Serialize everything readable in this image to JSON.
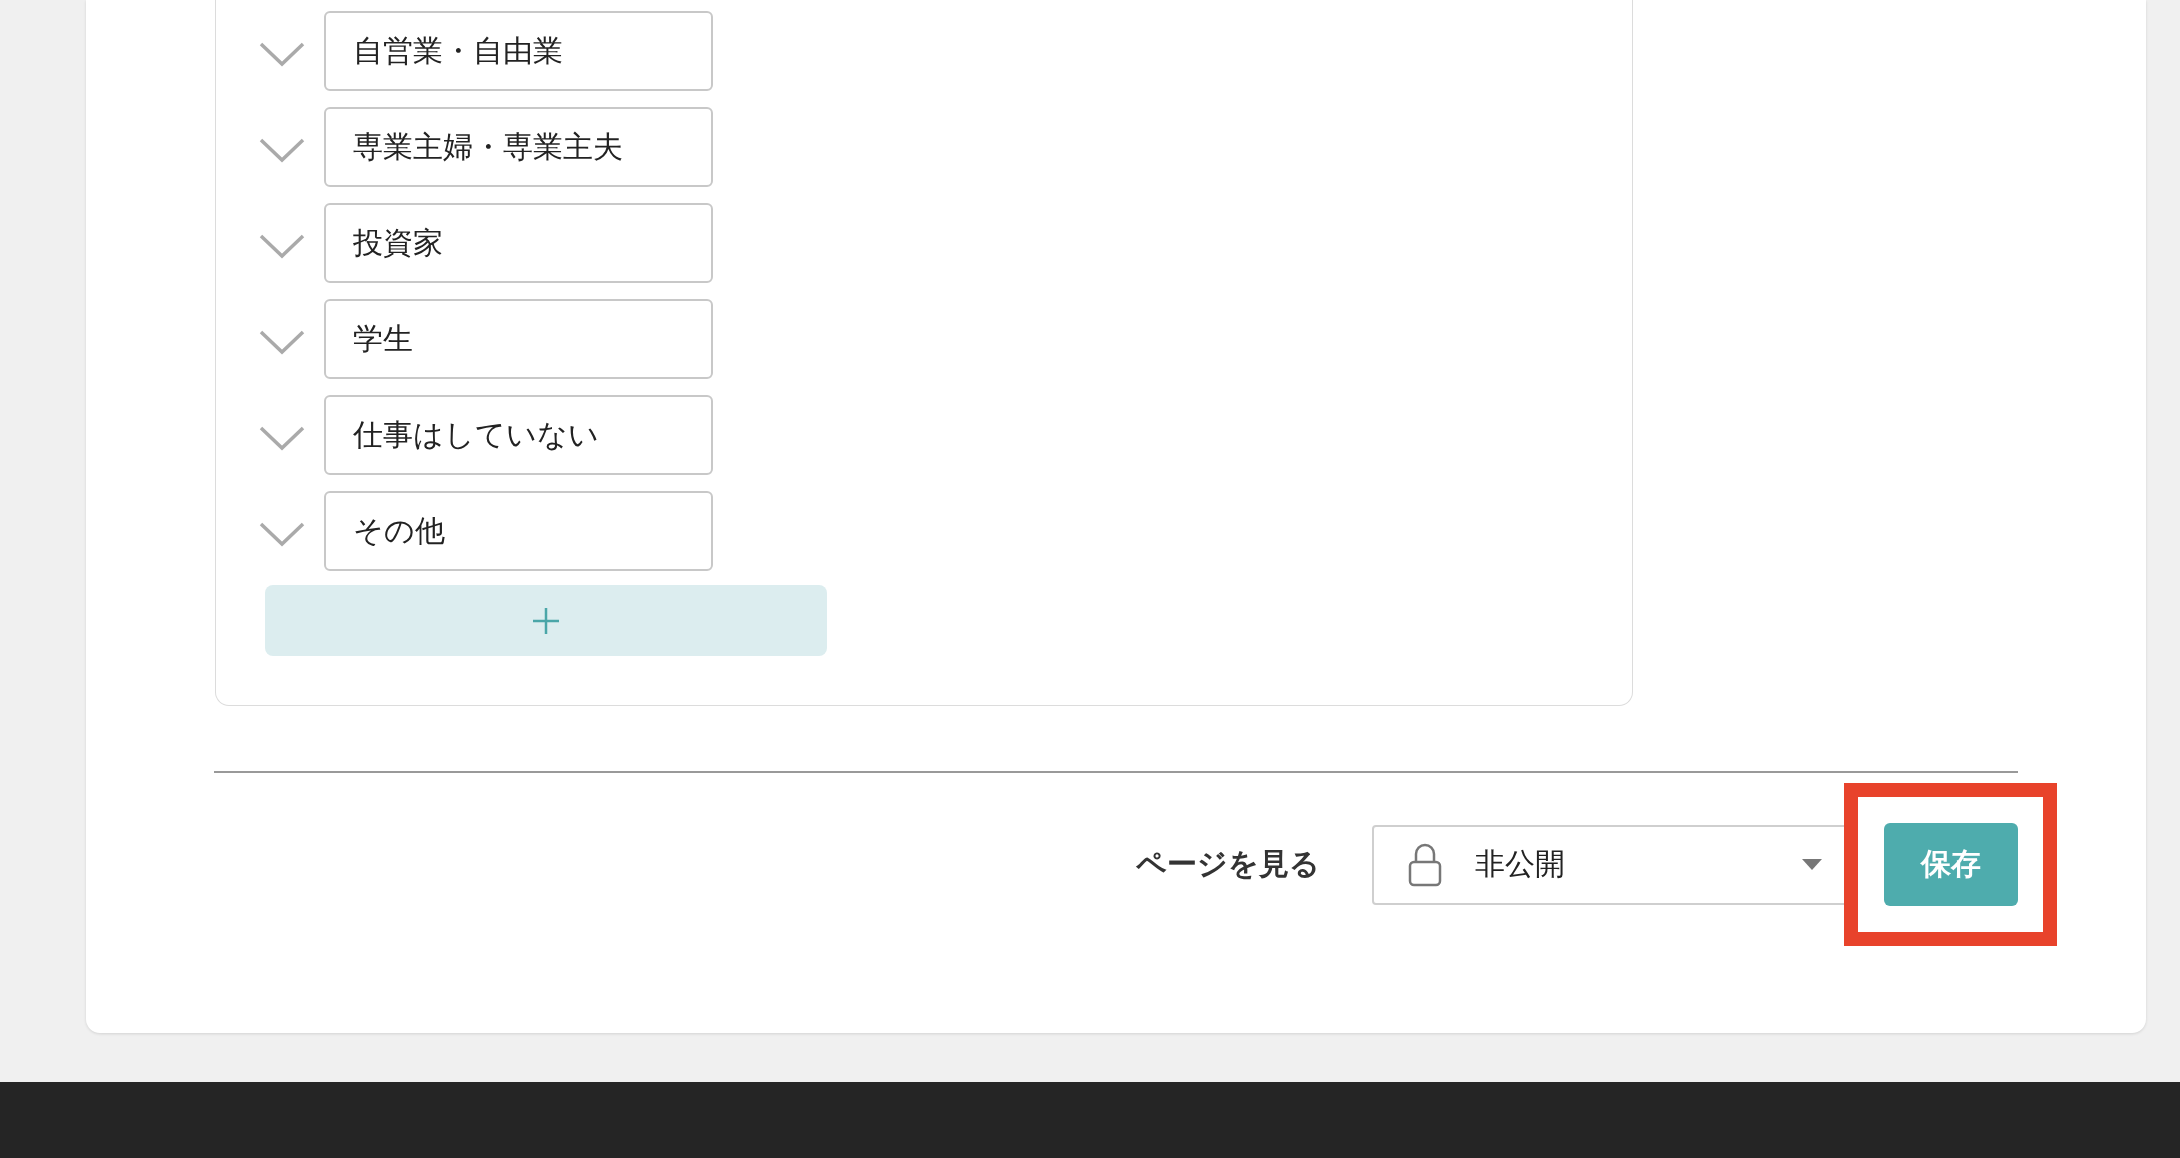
{
  "options": [
    {
      "value": "自営業・自由業"
    },
    {
      "value": "専業主婦・専業主夫"
    },
    {
      "value": "投資家"
    },
    {
      "value": "学生"
    },
    {
      "value": "仕事はしていない"
    },
    {
      "value": "その他"
    }
  ],
  "footer": {
    "view_page_link": "ページを見る",
    "visibility_select": {
      "value": "非公開"
    },
    "save_button": "保存",
    "save_highlighted": true
  }
}
